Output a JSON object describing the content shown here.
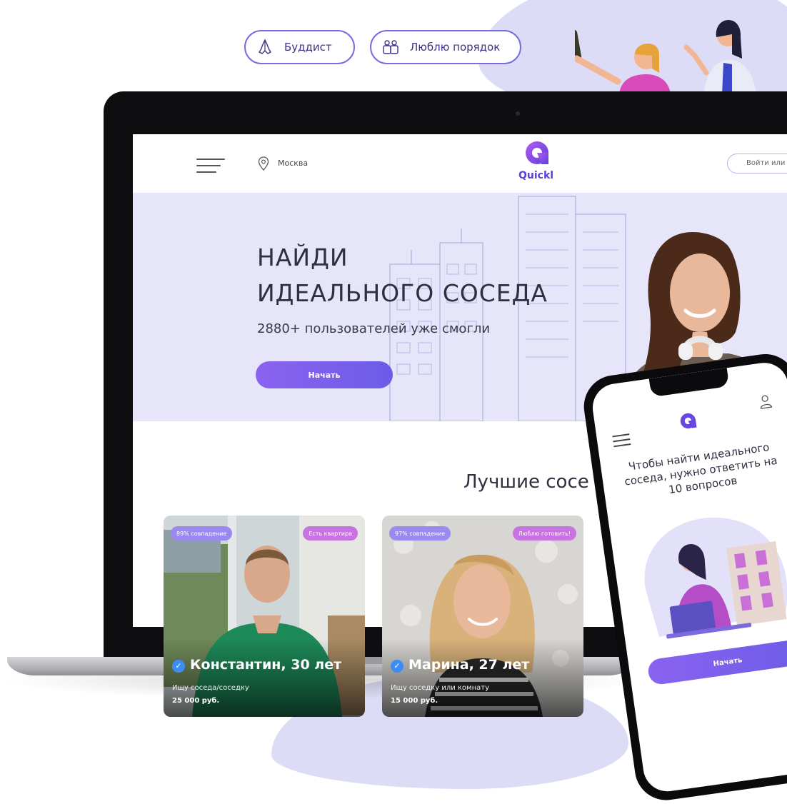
{
  "tags": [
    {
      "label": "Буддист",
      "icon": "praying-hands-icon"
    },
    {
      "label": "Люблю порядок",
      "icon": "people-icon"
    }
  ],
  "site": {
    "city": "Москва",
    "logo_text": "Quickl",
    "login_label": "Войти или"
  },
  "hero": {
    "title_line1": "НАЙДИ",
    "title_line2": "ИДЕАЛЬНОГО СОСЕДА",
    "subtitle": "2880+ пользователей уже смогли",
    "cta": "Начать"
  },
  "best_title": "Лучшие сосе",
  "cards": [
    {
      "match": "89% совпадение",
      "badge": "Есть квартира",
      "name": "Константин, 30 лет",
      "desc": "Ищу соседа/соседку",
      "price": "25 000 руб."
    },
    {
      "match": "97% совпадение",
      "badge": "Люблю готовить!",
      "name": "Марина, 27 лет",
      "desc": "Ищу соседку или комнату",
      "price": "15 000 руб."
    }
  ],
  "phone": {
    "question": "Чтобы найти идеального соседа, нужно ответить на 10 вопросов",
    "cta": "Начать"
  },
  "colors": {
    "accent": "#6c5ce7",
    "accent_light": "#e6e5fa",
    "pill_border": "#7b6ae0"
  }
}
